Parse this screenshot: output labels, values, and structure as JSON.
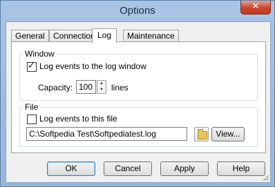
{
  "window": {
    "title": "Options",
    "close_glyph": "✕"
  },
  "tabs": [
    {
      "label": "General"
    },
    {
      "label": "Connection"
    },
    {
      "label": "Log"
    },
    {
      "label": "Maintenance"
    }
  ],
  "window_group": {
    "label": "Window",
    "log_checkbox_label": "Log events to the log window",
    "log_checked": true,
    "capacity_label": "Capacity:",
    "capacity_value": "100",
    "capacity_unit": "lines"
  },
  "file_group": {
    "label": "File",
    "log_checkbox_label": "Log events to this file",
    "log_checked": false,
    "path_value": "C:\\Softpedia Test\\Softpediatest.log",
    "view_label": "View..."
  },
  "buttons": {
    "ok": "OK",
    "cancel": "Cancel",
    "apply": "Apply",
    "help": "Help"
  }
}
